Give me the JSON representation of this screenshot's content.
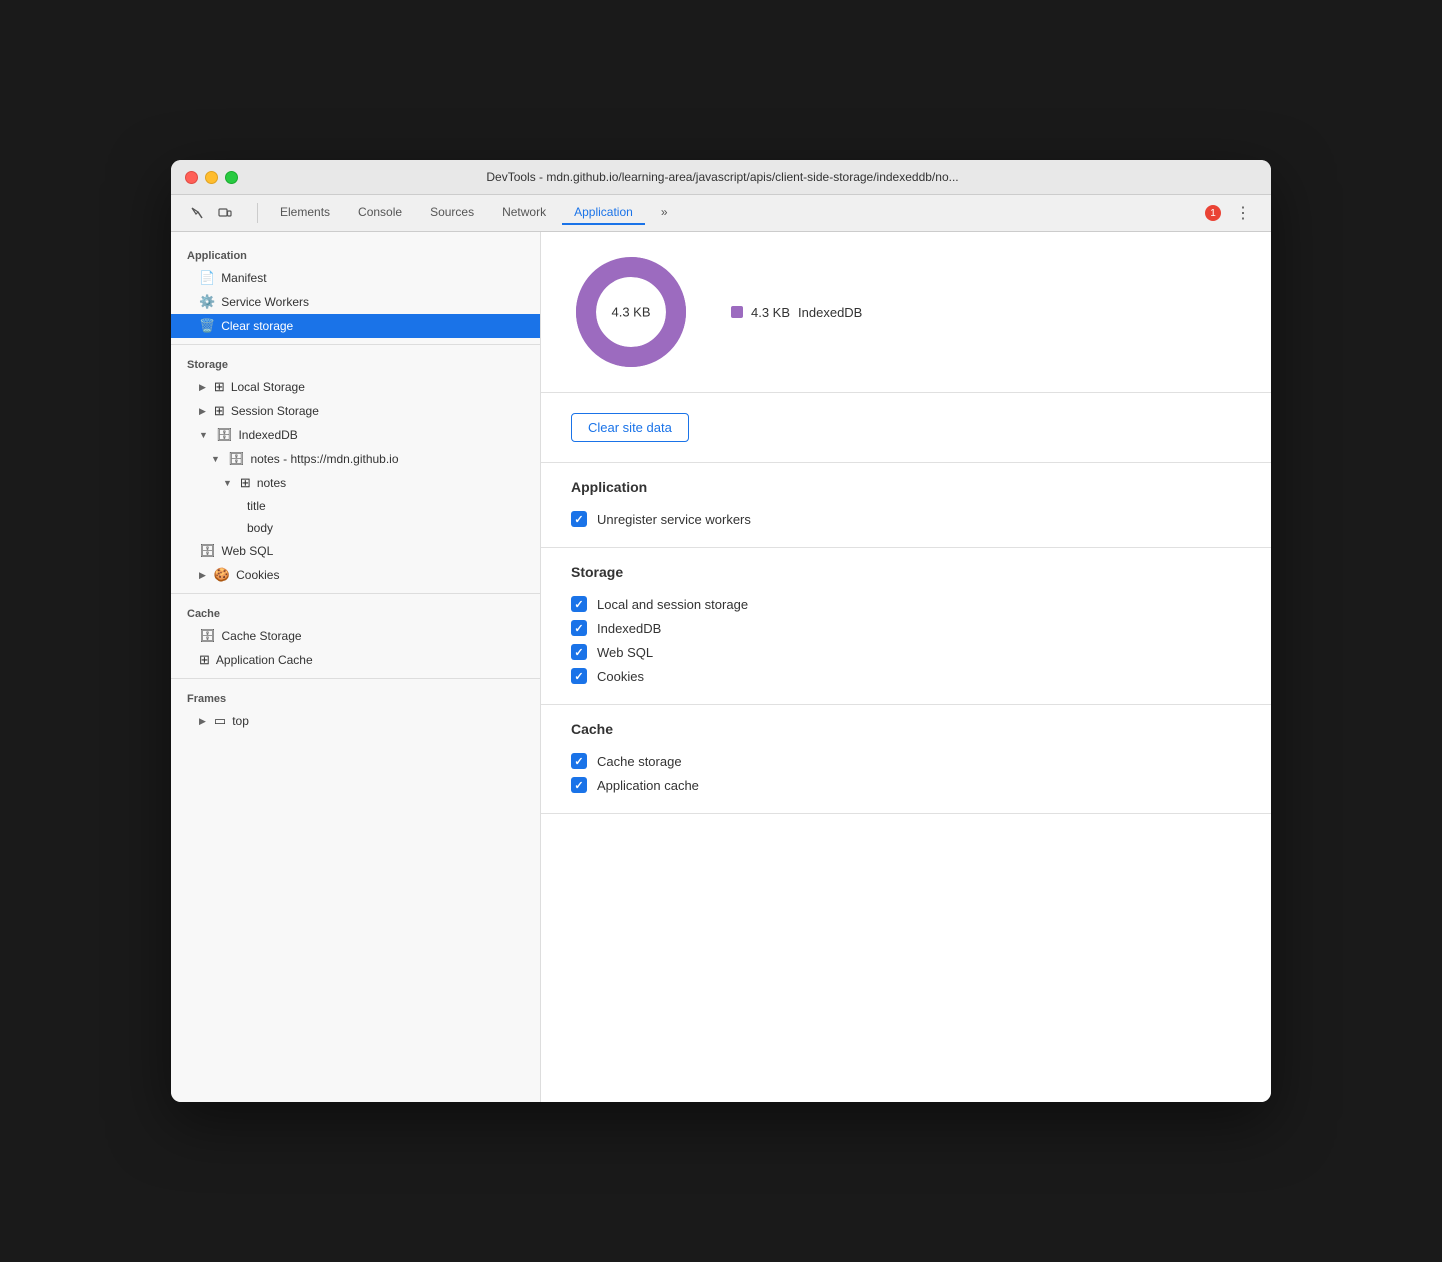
{
  "window": {
    "title": "DevTools - mdn.github.io/learning-area/javascript/apis/client-side-storage/indexeddb/no..."
  },
  "toolbar": {
    "tabs": [
      {
        "label": "Elements",
        "active": false
      },
      {
        "label": "Console",
        "active": false
      },
      {
        "label": "Sources",
        "active": false
      },
      {
        "label": "Network",
        "active": false
      },
      {
        "label": "Application",
        "active": true
      }
    ],
    "error_count": "1",
    "more_label": "»"
  },
  "sidebar": {
    "application_label": "Application",
    "manifest_label": "Manifest",
    "service_workers_label": "Service Workers",
    "clear_storage_label": "Clear storage",
    "storage_label": "Storage",
    "local_storage_label": "Local Storage",
    "session_storage_label": "Session Storage",
    "indexeddb_label": "IndexedDB",
    "notes_db_label": "notes - https://mdn.github.io",
    "notes_store_label": "notes",
    "title_field_label": "title",
    "body_field_label": "body",
    "web_sql_label": "Web SQL",
    "cookies_label": "Cookies",
    "cache_label": "Cache",
    "cache_storage_label": "Cache Storage",
    "application_cache_label": "Application Cache",
    "frames_label": "Frames",
    "top_label": "top"
  },
  "content": {
    "donut_value": "4.3 KB",
    "legend_value": "4.3 KB",
    "legend_label": "IndexedDB",
    "clear_btn_label": "Clear site data",
    "app_section_title": "Application",
    "unregister_sw_label": "Unregister service workers",
    "storage_section_title": "Storage",
    "local_session_label": "Local and session storage",
    "indexeddb_check_label": "IndexedDB",
    "websql_check_label": "Web SQL",
    "cookies_check_label": "Cookies",
    "cache_section_title": "Cache",
    "cache_storage_check_label": "Cache storage",
    "app_cache_check_label": "Application cache"
  },
  "colors": {
    "purple": "#9c6bbf",
    "blue": "#1a73e8",
    "active_bg": "#1a73e8"
  }
}
